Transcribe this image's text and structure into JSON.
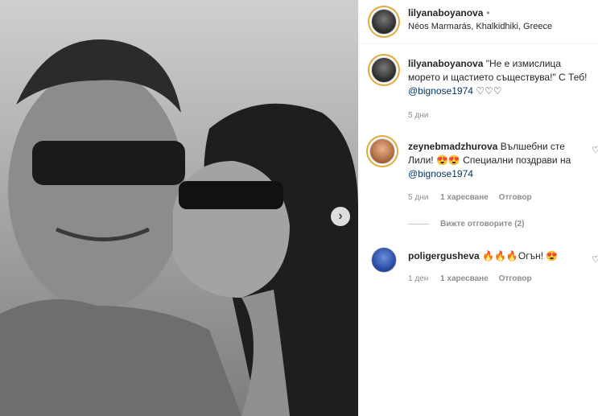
{
  "post": {
    "username": "lilyanaboyanova",
    "dot": "•",
    "location": "Néos Marmarás, Khalkidhiki, Greece",
    "next_icon": "chevron-right-icon"
  },
  "caption": {
    "username": "lilyanaboyanova",
    "text": "\"Не е измислица морето и щастието съществува!\" С Теб! ",
    "mention": "@bignose1974",
    "hearts": " ♡♡♡",
    "time": "5 дни"
  },
  "comments": [
    {
      "username": "zeynebmadzhurova",
      "text": "Вълшебни сте Лили! 😍😍 Специални поздрави на ",
      "mention": "@bignose1974",
      "time": "5 дни",
      "likes": "1 харесване",
      "reply": "Отговор",
      "view_replies": "Вижте отговорите (2)"
    },
    {
      "username": "poligergusheva",
      "text": "🔥🔥🔥Огън! 😍",
      "time": "1 ден",
      "likes": "1 харесване",
      "reply": "Отговор"
    }
  ],
  "colors": {
    "link": "#00376b",
    "muted": "#8e8e8e",
    "text": "#262626"
  }
}
